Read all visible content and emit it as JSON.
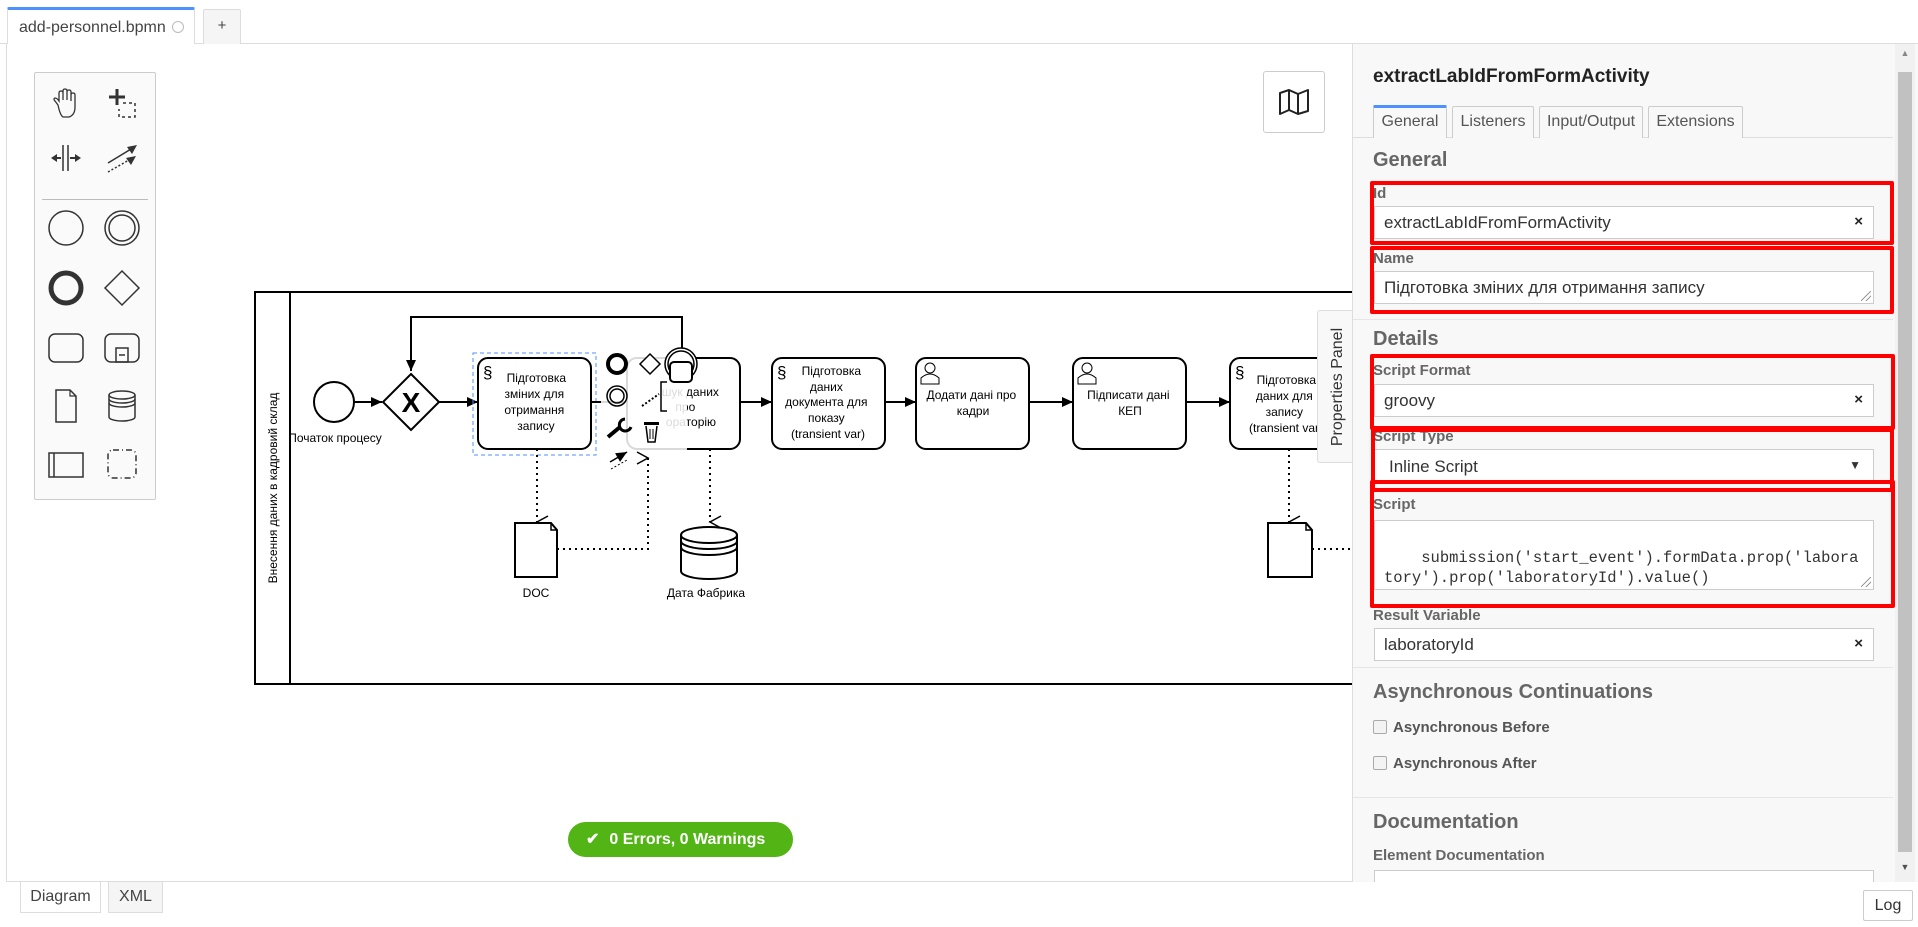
{
  "file_tabs": {
    "active_tab": {
      "label": "add-personnel.bpmn",
      "unsaved_indicator": "circle-icon"
    },
    "add_tab_label": "+"
  },
  "palette": {
    "tools": [
      {
        "name": "hand-tool",
        "icon": "hand-icon"
      },
      {
        "name": "lasso-tool",
        "icon": "lasso-icon"
      },
      {
        "name": "space-tool",
        "icon": "space-icon"
      },
      {
        "name": "global-connect-tool",
        "icon": "connect-icon"
      }
    ],
    "shapes": [
      {
        "name": "start-event",
        "icon": "circle-icon"
      },
      {
        "name": "intermediate-event",
        "icon": "double-circle-icon"
      },
      {
        "name": "end-event",
        "icon": "bold-circle-icon"
      },
      {
        "name": "gateway",
        "icon": "diamond-icon"
      },
      {
        "name": "task",
        "icon": "rounded-rect-icon"
      },
      {
        "name": "subprocess",
        "icon": "subprocess-icon"
      },
      {
        "name": "data-object",
        "icon": "document-icon"
      },
      {
        "name": "data-store",
        "icon": "database-icon"
      },
      {
        "name": "participant",
        "icon": "pool-icon"
      },
      {
        "name": "group",
        "icon": "group-icon"
      }
    ]
  },
  "minimap": {
    "icon": "map-icon"
  },
  "diagram": {
    "pool_label": "Внесення даних в кадровий склад",
    "start_event_label": "Початок процесу",
    "tasks": [
      {
        "id": "t1",
        "type": "script",
        "lines": [
          "Підготовка",
          "зміних для",
          "отримання",
          "запису"
        ],
        "selected": true
      },
      {
        "id": "t2",
        "type": "service",
        "lines": [
          "шук даних",
          "про",
          "ораторію"
        ]
      },
      {
        "id": "t3",
        "type": "script",
        "lines": [
          "Підготовка",
          "даних",
          "документа для",
          "показу",
          "(transient var)"
        ]
      },
      {
        "id": "t4",
        "type": "user",
        "lines": [
          "Додати дані про",
          "кадри"
        ]
      },
      {
        "id": "t5",
        "type": "user",
        "lines": [
          "Підписати дані",
          "КЕП"
        ]
      },
      {
        "id": "t6",
        "type": "script",
        "lines": [
          "Підготовка",
          "даних для",
          "запису",
          "(transient var)"
        ]
      }
    ],
    "data_object_label": "DOC",
    "data_store_label": "Дата Фабрика"
  },
  "properties_toggle_label": "Properties Panel",
  "validation": {
    "text": "0 Errors, 0 Warnings",
    "color": "#52b415"
  },
  "properties": {
    "title": "extractLabIdFromFormActivity",
    "tabs": [
      "General",
      "Listeners",
      "Input/Output",
      "Extensions"
    ],
    "active_tab": "General",
    "general_group": "General",
    "id_label": "Id",
    "id_value": "extractLabIdFromFormActivity",
    "name_label": "Name",
    "name_value": "Підготовка зміних для отримання запису",
    "details_group": "Details",
    "script_format_label": "Script Format",
    "script_format_value": "groovy",
    "script_type_label": "Script Type",
    "script_type_value": "Inline Script",
    "script_label": "Script",
    "script_value": "submission('start_event').formData.prop('laboratory').prop('laboratoryId').value()",
    "result_variable_label": "Result Variable",
    "result_variable_value": "laboratoryId",
    "async_group": "Asynchronous Continuations",
    "async_before_label": "Asynchronous Before",
    "async_before_checked": false,
    "async_after_label": "Asynchronous After",
    "async_after_checked": false,
    "documentation_group": "Documentation",
    "element_documentation_label": "Element Documentation",
    "element_documentation_value": "",
    "clear_symbol": "×",
    "highlight_color": "#ff0000"
  },
  "bottom_tabs": [
    "Diagram",
    "XML"
  ],
  "active_bottom_tab": "Diagram",
  "log_button_label": "Log"
}
